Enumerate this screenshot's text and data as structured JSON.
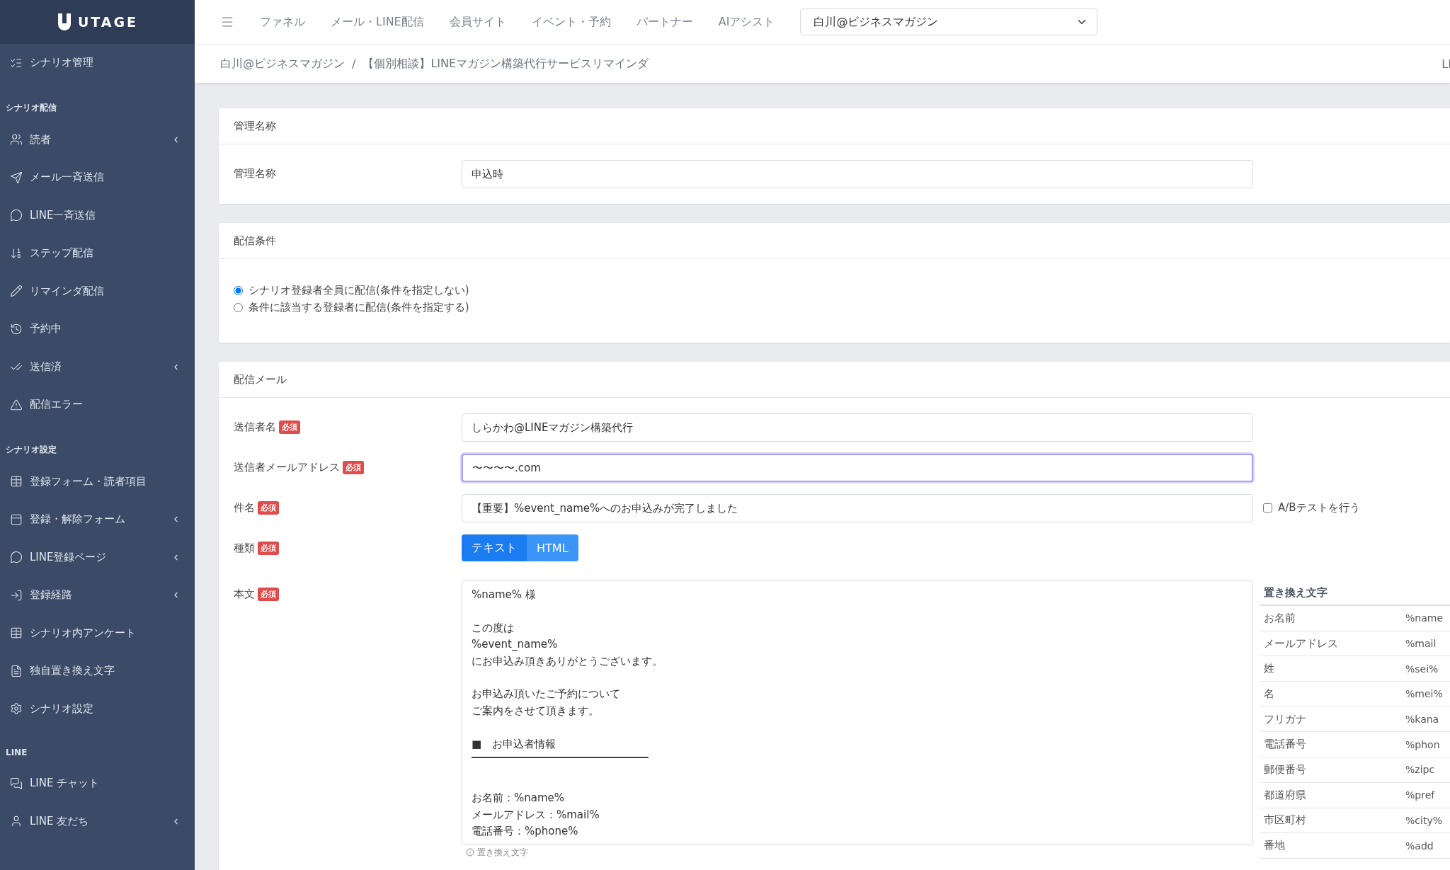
{
  "sidebar": {
    "logo": "UTAGE",
    "top_item": {
      "label": "シナリオ管理",
      "expandable": false
    },
    "sections": [
      {
        "heading": "シナリオ配信",
        "items": [
          {
            "label": "読者",
            "expandable": true
          },
          {
            "label": "メール一斉送信",
            "expandable": false
          },
          {
            "label": "LINE一斉送信",
            "expandable": false
          },
          {
            "label": "ステップ配信",
            "expandable": false
          },
          {
            "label": "リマインダ配信",
            "expandable": false
          },
          {
            "label": "予約中",
            "expandable": false
          },
          {
            "label": "送信済",
            "expandable": true
          },
          {
            "label": "配信エラー",
            "expandable": false
          }
        ]
      },
      {
        "heading": "シナリオ設定",
        "items": [
          {
            "label": "登録フォーム・読者項目",
            "expandable": false
          },
          {
            "label": "登録・解除フォーム",
            "expandable": true
          },
          {
            "label": "LINE登録ページ",
            "expandable": true
          },
          {
            "label": "登録経路",
            "expandable": true
          },
          {
            "label": "シナリオ内アンケート",
            "expandable": false
          },
          {
            "label": "独自置き換え文字",
            "expandable": false
          },
          {
            "label": "シナリオ設定",
            "expandable": false
          }
        ]
      },
      {
        "heading": "LINE",
        "items": [
          {
            "label": "LINE チャット",
            "expandable": false
          },
          {
            "label": "LINE 友だち",
            "expandable": true
          }
        ]
      }
    ]
  },
  "topbar": {
    "nav": [
      "ファネル",
      "メール・LINE配信",
      "会員サイト",
      "イベント・予約",
      "パートナー",
      "AIアシスト"
    ],
    "account_select": "白川@ビジネスマガジン"
  },
  "breadcrumb": {
    "items": [
      "白川@ビジネスマガジン",
      "【個別相談】LINEマガジン構築代行サービスリマインダ"
    ],
    "separator": "/",
    "right": "LI"
  },
  "cards": [
    {
      "title": "管理名称",
      "kind": "name",
      "label": "管理名称",
      "value": "申込時"
    },
    {
      "title": "配信条件",
      "kind": "radios",
      "options": [
        {
          "label": "シナリオ登録者全員に配信(条件を指定しない)",
          "selected": true
        },
        {
          "label": "条件に該当する登録者に配信(条件を指定する)",
          "selected": false
        }
      ]
    },
    {
      "title": "配信メール",
      "kind": "mail"
    }
  ],
  "mail": {
    "fields": [
      {
        "label": "送信者名",
        "badge": "必須",
        "value": "しらかわ@LINEマガジン構築代行",
        "focused": false
      },
      {
        "label": "送信者メールアドレス",
        "badge": "必須",
        "value": "〜〜〜〜.com",
        "focused": true
      },
      {
        "label": "件名",
        "badge": "必須",
        "value": "【重要】%event_name%へのお申込みが完了しました",
        "focused": false
      }
    ],
    "ab_test": {
      "label": "A/Bテストを行う",
      "checked": false
    },
    "type": {
      "label": "種類",
      "badge": "必須",
      "options": [
        {
          "label": "テキスト",
          "selected": true
        },
        {
          "label": "HTML",
          "selected": false
        }
      ]
    },
    "body": {
      "label": "本文",
      "badge": "必須",
      "lines": [
        {
          "kind": "text",
          "text": "%name% 様"
        },
        {
          "kind": "blank"
        },
        {
          "kind": "text",
          "text": "この度は"
        },
        {
          "kind": "text",
          "text": "%event_name%"
        },
        {
          "kind": "text",
          "text": "にお申込み頂きありがとうございます。"
        },
        {
          "kind": "blank"
        },
        {
          "kind": "text",
          "text": "お申込み頂いたご予約について"
        },
        {
          "kind": "text",
          "text": "ご案内をさせて頂きます。"
        },
        {
          "kind": "blank"
        },
        {
          "kind": "text",
          "text": "■　お申込者情報"
        },
        {
          "kind": "rule"
        },
        {
          "kind": "blank"
        },
        {
          "kind": "text",
          "text": "お名前：%name%"
        },
        {
          "kind": "text",
          "text": "メールアドレス：%mail%"
        },
        {
          "kind": "text",
          "text": "電話番号：%phone%"
        }
      ],
      "hint": "置き換え文字"
    },
    "replacements": {
      "title": "置き換え文字",
      "rows": [
        {
          "name": "お名前",
          "code": "%name"
        },
        {
          "name": "メールアドレス",
          "code": "%mail"
        },
        {
          "name": "姓",
          "code": "%sei%"
        },
        {
          "name": "名",
          "code": "%mei%"
        },
        {
          "name": "フリガナ",
          "code": "%kana"
        },
        {
          "name": "電話番号",
          "code": "%phon"
        },
        {
          "name": "郵便番号",
          "code": "%zipc"
        },
        {
          "name": "都道府県",
          "code": "%pref"
        },
        {
          "name": "市区町村",
          "code": "%city%"
        },
        {
          "name": "番地",
          "code": "%add"
        }
      ]
    }
  }
}
